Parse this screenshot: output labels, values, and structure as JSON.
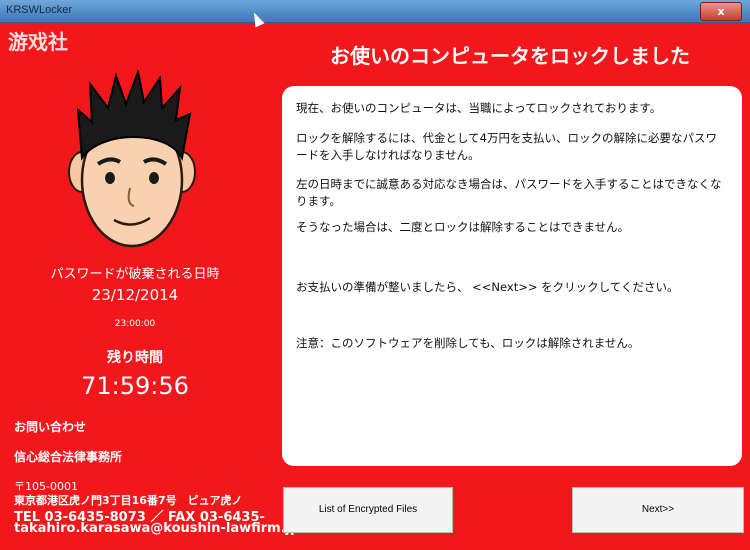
{
  "window": {
    "title": "KRSWLocker",
    "close_label": "x"
  },
  "watermark": "游戏社",
  "avatar": {
    "icon": "cartoon-face-icon"
  },
  "left": {
    "deadline_label": "パスワードが破棄される日時",
    "deadline_date": "23/12/2014",
    "deadline_time": "23:00:00",
    "remaining_label": "残り時間",
    "countdown": "71:59:56",
    "contact_label": "お問い合わせ",
    "firm_name": "信心総合法律事務所",
    "postal": "〒105-0001",
    "address": "東京都港区虎ノ門3丁目16番7号　ピュア虎ノ",
    "tel_fax": "TEL 03-6435-8073 ／ FAX 03-6435-",
    "email": "takahiro.karasawa@koushin-lawfirm.jp"
  },
  "main": {
    "heading": "お使いのコンピュータをロックしました",
    "paragraphs": [
      "現在、お使いのコンピュータは、当職によってロックされております。",
      "ロックを解除するには、代金として4万円を支払い、ロックの解除に必要なパスワードを入手しなければなりません。",
      "左の日時までに誠意ある対応なき場合は、パスワードを入手することはできなくなります。",
      "そうなった場合は、二度とロックは解除することはできません。",
      "お支払いの準備が整いましたら、 <<Next>> をクリックしてください。",
      "注意：このソフトウェアを削除しても、ロックは解除されません。"
    ]
  },
  "buttons": {
    "list_files": "List of Encrypted Files",
    "next": "Next>>"
  },
  "colors": {
    "background": "#f2171a",
    "text": "#ffffff",
    "panel": "#ffffff",
    "titlebar": "#4f8fcb"
  }
}
